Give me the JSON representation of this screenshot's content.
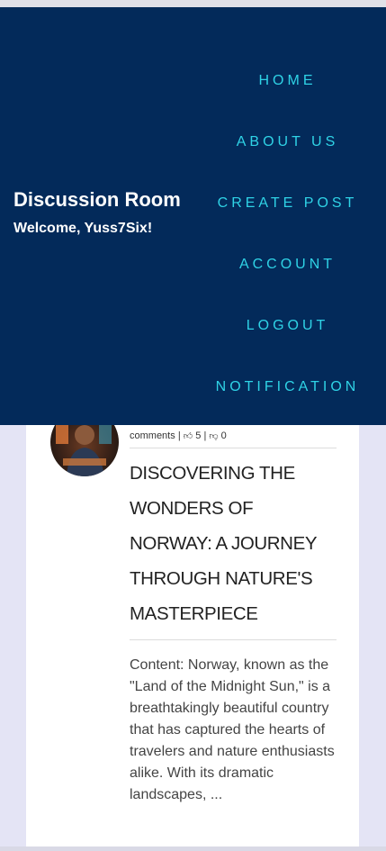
{
  "brand": {
    "title": "Discussion Room",
    "welcome": "Welcome, Yuss7Six!"
  },
  "nav": [
    {
      "label": "HOME"
    },
    {
      "label": "ABOUT US"
    },
    {
      "label": "CREATE POST"
    },
    {
      "label": "ACCOUNT"
    },
    {
      "label": "LOGOUT"
    },
    {
      "label": "NOTIFICATION"
    }
  ],
  "post": {
    "comments_label": "comments",
    "likes": "5",
    "dislikes": "0",
    "title": "DISCOVERING THE WONDERS OF NORWAY: A JOURNEY THROUGH NATURE'S MASTERPIECE",
    "content": "Content: Norway, known as the \"Land of the Midnight Sun,\" is a breathtakingly beautiful country that has captured the hearts of travelers and nature enthusiasts alike. With its dramatic landscapes, ..."
  },
  "colors": {
    "header_bg": "#032a5a",
    "nav_text": "#2fd3e6",
    "page_bg": "#e4e4f5"
  },
  "icons": {
    "like": "thumbs-up-icon",
    "dislike": "thumbs-down-icon"
  }
}
